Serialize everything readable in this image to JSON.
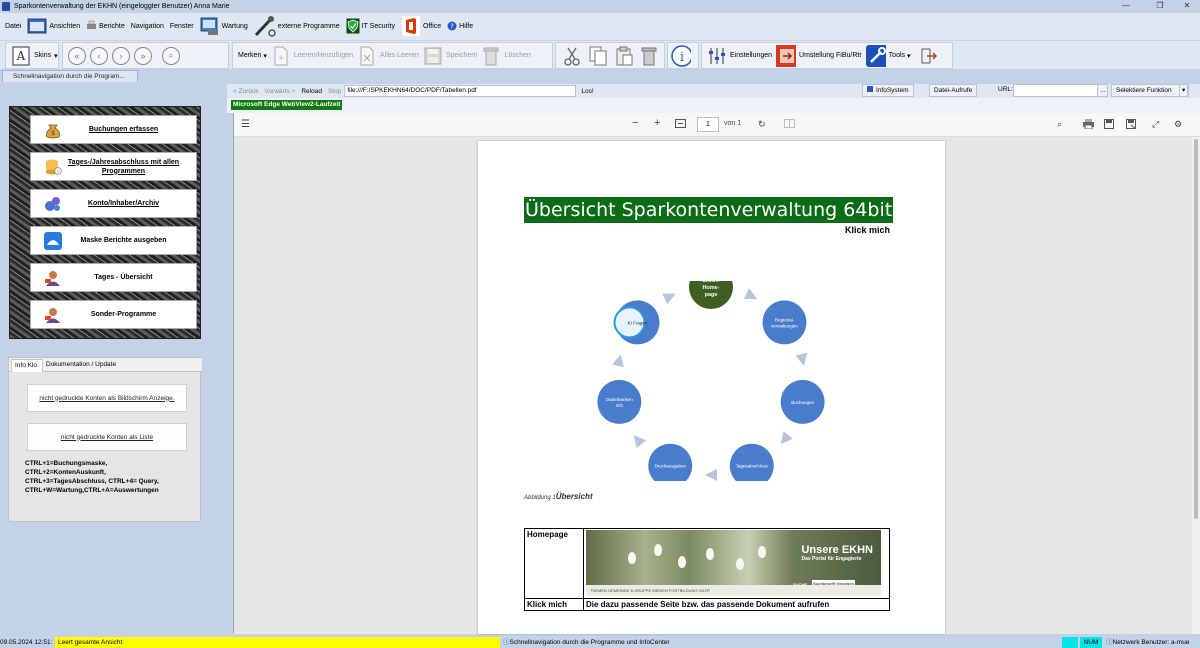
{
  "window": {
    "title": "Sparkontenverwaltung der EKHN   (eingeloggter Benutzer)   Anna Marie",
    "min_glyph": "—",
    "max_glyph": "❐",
    "close_glyph": "✕"
  },
  "menu": {
    "items": [
      "Datei",
      "Ansichten",
      "Berichte",
      "Navigation",
      "Fenster",
      "Wartung",
      "externe Programme",
      "IT Security",
      "Office",
      "Hilfe"
    ]
  },
  "toolbar": {
    "skins": "Skins",
    "merken": "Merken",
    "leeren_hinzufuegen": "Leeren/Hinzufügen",
    "alles_leeren": "Alles Leeren",
    "speichern": "Speichern",
    "loeschen": "Löschen",
    "einstellungen": "Einstellungen",
    "umstellung": "Umstellung FiBu/Rtr",
    "tools": "Tools"
  },
  "tabstrip": {
    "tab": "Schnellnavigation durch die Program..."
  },
  "leftnav": {
    "buttons": [
      {
        "label": "Buchungen erfassen",
        "underline": true
      },
      {
        "label": "Tages-/Jahresabschluss mit allen Programmen",
        "underline": true
      },
      {
        "label": "Konto/Inhaber/Archiv",
        "underline": true
      },
      {
        "label": "Maske Berichte ausgeben",
        "underline": false
      },
      {
        "label": "Tages - Übersicht",
        "underline": false
      },
      {
        "label": "Sonder-Programme",
        "underline": false
      }
    ]
  },
  "infopanel": {
    "tab_info": "Info Klo.",
    "tab_doku": "Dokumentation / Update",
    "link1": "nicht gedruckte Konten als Bildschirm Anzeige.",
    "link2": "nicht gedruckte Konten als Liste",
    "shortcuts": [
      "CTRL+1=Buchungsmaske,",
      "CTRL+2=KontenAuskunft,",
      "CTRL+3=TagesAbschluss, CTRL+4= Query,",
      "CTRL+W=Wartung,CTRL+A=Auswertungen"
    ]
  },
  "browser": {
    "back": "< Zurück",
    "forward": "Vorwärts >",
    "reload": "Reload",
    "stop": "Stop",
    "url": "file:///F:/SPKEKHN64/DOC/PDF/Tabellen.pdf",
    "go": "Los!",
    "infosystem": "InfoSystem",
    "datei_aufrufe": "Datei-Aufrufe",
    "url_label": "URL:",
    "url_ellipsis": "...",
    "selektiere": "Selektiere Funktion",
    "runtime": "Microsoft Edge WebView2-Laufzeit"
  },
  "pdfviewer": {
    "page_current": "1",
    "page_of": "von 1"
  },
  "pdf": {
    "title": "Übersicht Sparkontenverwaltung 64bit",
    "klick_mich": "Klick mich",
    "diagram": {
      "center_color": "#3f5e22",
      "node_color": "#4a7ccc",
      "nodes": [
        {
          "label": "EKHN-\nHome-\npage"
        },
        {
          "label": "Regional-\nverwaltungen"
        },
        {
          "label": "Buchungen"
        },
        {
          "label": "Tagesabschluss"
        },
        {
          "label": "Druckausgaben"
        },
        {
          "label": "Datenbanken\nInfo"
        },
        {
          "label": "KI Fragen"
        }
      ]
    },
    "caption_prefix": "Abbildung 1",
    "caption_title": "Übersicht",
    "table": {
      "row1_label": "Homepage",
      "row2_label": "Klick mich",
      "row2_text": "Die dazu passende Seite bzw. das passende Dokument aufrufen"
    },
    "banner": {
      "logo_big": "Unsere EKHN",
      "logo_small": "Das Portal für Engagierte",
      "nav": "THEMEN   GEMEINDE & GRUPPE   MEDIEN   FORTBILDUNG   HILFE",
      "search_label": "SUCHE",
      "search_placeholder": "Suchbegriff eingeben"
    }
  },
  "status": {
    "datetime": "09.05.2024 12:51:",
    "message": "Leert gesamte Ansicht",
    "nav_hint": "Schnellnavigation durch die Programme und InfoCenter",
    "num": "NUM",
    "network": "Netzwerk Benutzer:  a-mue"
  }
}
